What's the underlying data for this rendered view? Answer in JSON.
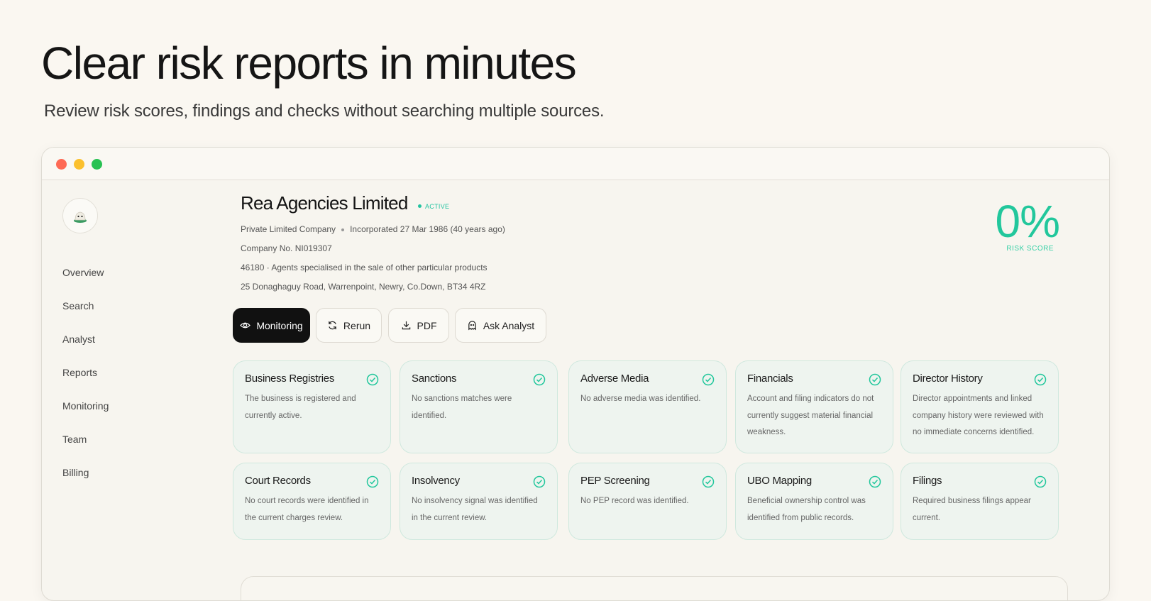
{
  "hero": {
    "title": "Clear risk reports in minutes",
    "subtitle": "Review risk scores, findings and checks without searching multiple sources."
  },
  "nav": {
    "items": [
      {
        "label": "Overview"
      },
      {
        "label": "Search"
      },
      {
        "label": "Analyst"
      },
      {
        "label": "Reports"
      },
      {
        "label": "Monitoring"
      },
      {
        "label": "Team"
      },
      {
        "label": "Billing"
      }
    ]
  },
  "company": {
    "name": "Rea Agencies Limited",
    "status": "ACTIVE",
    "type": "Private Limited Company",
    "incorporated": "Incorporated 27 Mar 1986 (40 years ago)",
    "number": "Company No. NI019307",
    "sic": "46180 · Agents specialised in the sale of other particular products",
    "address": "25 Donaghaguy Road, Warrenpoint, Newry, Co.Down, BT34 4RZ"
  },
  "risk": {
    "score": "0%",
    "label": "RISK SCORE"
  },
  "actions": {
    "monitoring": "Monitoring",
    "rerun": "Rerun",
    "pdf": "PDF",
    "ask_analyst": "Ask Analyst"
  },
  "checks": [
    {
      "title": "Business Registries",
      "desc": "The business is registered and currently active."
    },
    {
      "title": "Sanctions",
      "desc": "No sanctions matches were identified."
    },
    {
      "title": "Adverse Media",
      "desc": "No adverse media was identified."
    },
    {
      "title": "Financials",
      "desc": "Account and filing indicators do not currently suggest material financial weakness."
    },
    {
      "title": "Director History",
      "desc": "Director appointments and linked company history were reviewed with no immediate concerns identified."
    },
    {
      "title": "Court Records",
      "desc": "No court records were identified in the current charges review."
    },
    {
      "title": "Insolvency",
      "desc": "No insolvency signal was identified in the current review."
    },
    {
      "title": "PEP Screening",
      "desc": "No PEP record was identified."
    },
    {
      "title": "UBO Mapping",
      "desc": "Beneficial ownership control was identified from public records."
    },
    {
      "title": "Filings",
      "desc": "Required business filings appear current."
    }
  ],
  "colors": {
    "accent": "#22c79c",
    "background": "#faf7f1",
    "card_bg": "#eef4ef"
  }
}
